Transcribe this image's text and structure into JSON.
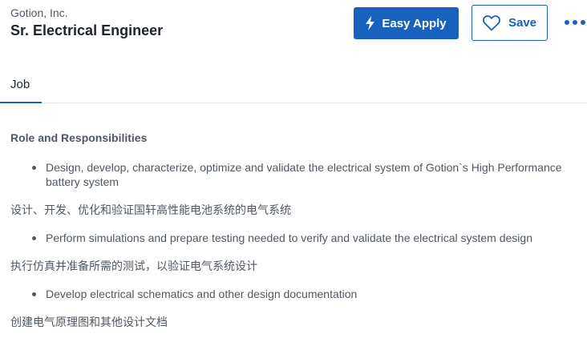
{
  "header": {
    "company": "Gotion, Inc.",
    "title": "Sr. Electrical Engineer"
  },
  "actions": {
    "easy_apply_label": "Easy Apply",
    "easy_apply_icon": "lightning-icon",
    "save_label": "Save",
    "save_icon": "heart-outline-icon",
    "more_icon": "more-horizontal-icon"
  },
  "tabs": [
    {
      "label": "Job",
      "active": true
    }
  ],
  "description": {
    "heading": "Role and Responsibilities",
    "items": [
      {
        "bullet": "Design, develop, characterize, optimize and validate the electrical system of Gotion`s High Performance battery system",
        "note": "设计、开发、优化和验证国轩高性能电池系统的电气系统"
      },
      {
        "bullet": "Perform simulations and prepare testing needed to verify and validate the electrical system design",
        "note": "执行仿真并准备所需的测试，以验证电气系统设计"
      },
      {
        "bullet": "Develop electrical schematics and other design documentation",
        "note": "创建电气原理图和其他设计文档"
      }
    ]
  },
  "colors": {
    "accent": "#1861bf",
    "text_dark": "#20262e",
    "text_body": "#505863"
  }
}
